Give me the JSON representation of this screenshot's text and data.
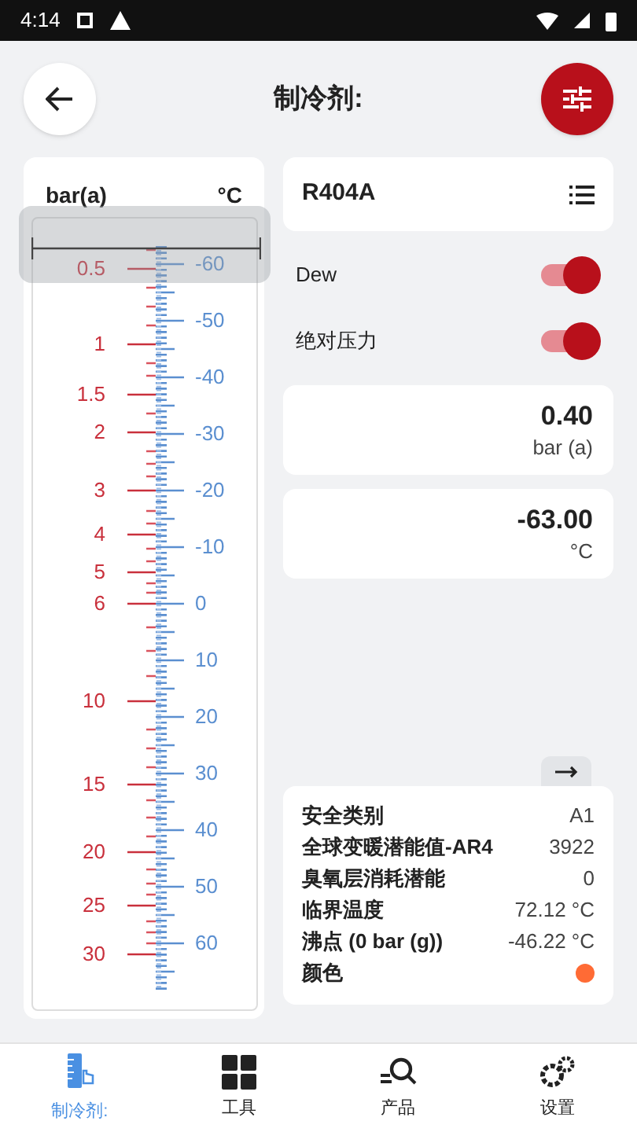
{
  "status_bar": {
    "time": "4:14"
  },
  "header": {
    "title": "制冷剂:"
  },
  "scale": {
    "pressure_unit": "bar(a)",
    "temperature_unit": "°C",
    "pressure_labels": [
      "0.5",
      "1",
      "1.5",
      "2",
      "3",
      "4",
      "5",
      "6",
      "10",
      "15",
      "20",
      "25",
      "30"
    ],
    "temperature_labels": [
      "-60",
      "-50",
      "-40",
      "-30",
      "-20",
      "-10",
      "0",
      "10",
      "20",
      "30",
      "40",
      "50",
      "60"
    ]
  },
  "refrigerant": {
    "name": "R404A"
  },
  "toggles": [
    {
      "label": "Dew",
      "on": true
    },
    {
      "label": "绝对压力",
      "on": true
    }
  ],
  "readings": [
    {
      "value": "0.40",
      "unit": "bar (a)"
    },
    {
      "value": "-63.00",
      "unit": "°C"
    }
  ],
  "properties": [
    {
      "label": "安全类别",
      "value": "A1"
    },
    {
      "label": "全球变暖潜能值-AR4",
      "value": "3922"
    },
    {
      "label": "臭氧层消耗潜能",
      "value": "0"
    },
    {
      "label": "临界温度",
      "value": "72.12 °C"
    },
    {
      "label": "沸点 (0 bar (g))",
      "value": "-46.22 °C"
    },
    {
      "label": "颜色",
      "color": "#ff6b35"
    }
  ],
  "nav": [
    {
      "label": "制冷剂:",
      "selected": true
    },
    {
      "label": "工具",
      "selected": false
    },
    {
      "label": "产品",
      "selected": false
    },
    {
      "label": "设置",
      "selected": false
    }
  ]
}
